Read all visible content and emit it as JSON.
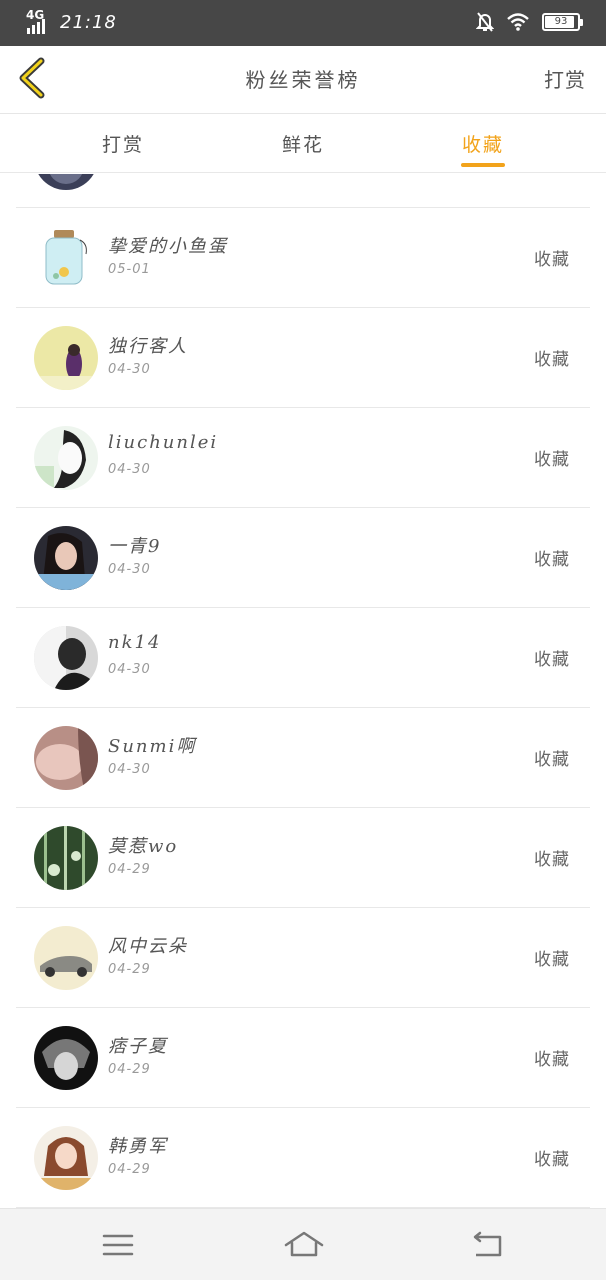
{
  "status_bar": {
    "network": "4G",
    "time": "21:18",
    "battery": "93"
  },
  "header": {
    "title": "粉丝荣誉榜",
    "action_label": "打赏"
  },
  "tabs": [
    {
      "label": "打赏",
      "active": false
    },
    {
      "label": "鲜花",
      "active": false
    },
    {
      "label": "收藏",
      "active": true
    }
  ],
  "accent_color": "#f2a31b",
  "list": [
    {
      "name": "",
      "date": "",
      "tag": ""
    },
    {
      "name": "挚爱的小鱼蛋",
      "date": "05-01",
      "tag": "收藏"
    },
    {
      "name": "独行客人",
      "date": "04-30",
      "tag": "收藏"
    },
    {
      "name": "liuchunlei",
      "date": "04-30",
      "tag": "收藏"
    },
    {
      "name": "一青9",
      "date": "04-30",
      "tag": "收藏"
    },
    {
      "name": "nk14",
      "date": "04-30",
      "tag": "收藏"
    },
    {
      "name": "Sunmi啊",
      "date": "04-30",
      "tag": "收藏"
    },
    {
      "name": "莫惹wo",
      "date": "04-29",
      "tag": "收藏"
    },
    {
      "name": "风中云朵",
      "date": "04-29",
      "tag": "收藏"
    },
    {
      "name": "痞子夏",
      "date": "04-29",
      "tag": "收藏"
    },
    {
      "name": "韩勇军",
      "date": "04-29",
      "tag": "收藏"
    }
  ],
  "bottom_nav": {
    "icons": [
      "menu-icon",
      "home-icon",
      "back-icon"
    ]
  }
}
